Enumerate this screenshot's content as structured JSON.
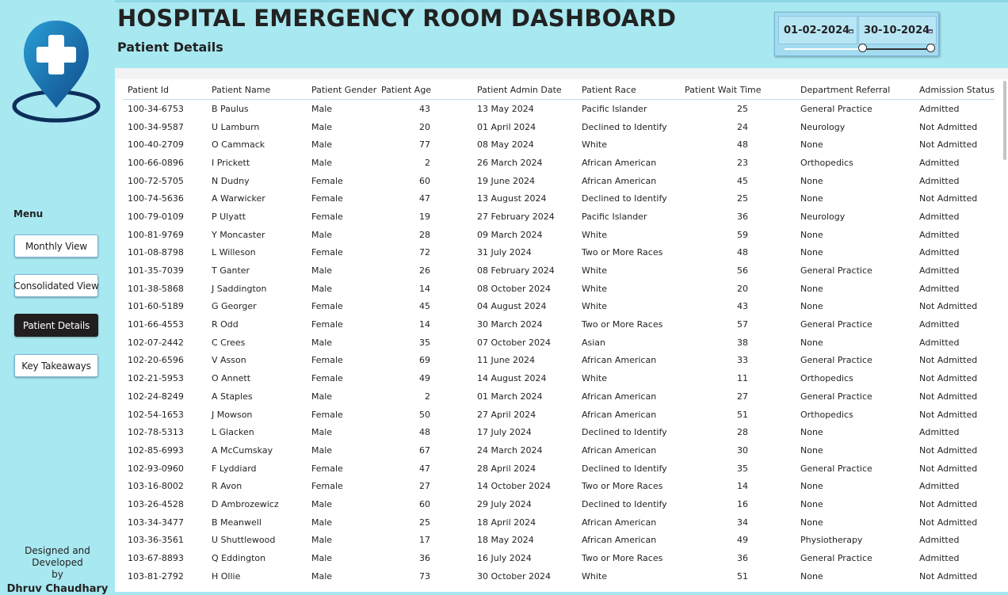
{
  "header": {
    "title": "HOSPITAL EMERGENCY ROOM DASHBOARD",
    "subtitle": "Patient Details"
  },
  "date_filter": {
    "start": "01-02-2024",
    "end": "30-10-2024",
    "range_fraction": [
      0.53,
      1.0
    ]
  },
  "sidebar": {
    "menu_label": "Menu",
    "items": [
      {
        "label": "Monthly View"
      },
      {
        "label": "Consolidated View"
      },
      {
        "label": "Patient Details",
        "active": true
      },
      {
        "label": "Key Takeaways"
      }
    ],
    "credit_line1": "Designed and Developed",
    "credit_line2": "by",
    "credit_name": "Dhruv Chaudhary"
  },
  "colors": {
    "background": "#a8e8f0",
    "active_button": "#221e20",
    "logo_blue": "#1a7fb5",
    "logo_dark": "#0d2d5a"
  },
  "table": {
    "columns": [
      "Patient Id",
      "Patient Name",
      "Patient Gender",
      "Patient Age",
      "Patient Admin Date",
      "Patient Race",
      "Patient Wait Time",
      "Department Referral",
      "Admission Status"
    ],
    "rows": [
      [
        "100-34-6753",
        "B Paulus",
        "Male",
        "43",
        "13 May 2024",
        "Pacific Islander",
        "25",
        "General Practice",
        "Admitted"
      ],
      [
        "100-34-9587",
        "U Lamburn",
        "Male",
        "20",
        "01 April 2024",
        "Declined to Identify",
        "24",
        "Neurology",
        "Not Admitted"
      ],
      [
        "100-40-2709",
        "O Cammack",
        "Male",
        "77",
        "08 May 2024",
        "White",
        "48",
        "None",
        "Not Admitted"
      ],
      [
        "100-66-0896",
        "I Prickett",
        "Male",
        "2",
        "26 March 2024",
        "African American",
        "23",
        "Orthopedics",
        "Admitted"
      ],
      [
        "100-72-5705",
        "N Dudny",
        "Female",
        "60",
        "19 June 2024",
        "African American",
        "45",
        "None",
        "Admitted"
      ],
      [
        "100-74-5636",
        "A Warwicker",
        "Female",
        "47",
        "13 August 2024",
        "Declined to Identify",
        "25",
        "None",
        "Not Admitted"
      ],
      [
        "100-79-0109",
        "P Ulyatt",
        "Female",
        "19",
        "27 February 2024",
        "Pacific Islander",
        "36",
        "Neurology",
        "Admitted"
      ],
      [
        "100-81-9769",
        "Y Moncaster",
        "Male",
        "28",
        "09 March 2024",
        "White",
        "59",
        "None",
        "Admitted"
      ],
      [
        "101-08-8798",
        "L Willeson",
        "Female",
        "72",
        "31 July 2024",
        "Two or More Races",
        "48",
        "None",
        "Admitted"
      ],
      [
        "101-35-7039",
        "T Ganter",
        "Male",
        "26",
        "08 February 2024",
        "White",
        "56",
        "General Practice",
        "Admitted"
      ],
      [
        "101-38-5868",
        "J Saddington",
        "Male",
        "14",
        "08 October 2024",
        "White",
        "20",
        "None",
        "Admitted"
      ],
      [
        "101-60-5189",
        "G Georger",
        "Female",
        "45",
        "04 August 2024",
        "White",
        "43",
        "None",
        "Not Admitted"
      ],
      [
        "101-66-4553",
        "R Odd",
        "Female",
        "14",
        "30 March 2024",
        "Two or More Races",
        "57",
        "General Practice",
        "Admitted"
      ],
      [
        "102-07-2442",
        "C Crees",
        "Male",
        "35",
        "07 October 2024",
        "Asian",
        "38",
        "None",
        "Admitted"
      ],
      [
        "102-20-6596",
        "V Asson",
        "Female",
        "69",
        "11 June 2024",
        "African American",
        "33",
        "General Practice",
        "Not Admitted"
      ],
      [
        "102-21-5953",
        "O Annett",
        "Female",
        "49",
        "14 August 2024",
        "White",
        "11",
        "Orthopedics",
        "Not Admitted"
      ],
      [
        "102-24-8249",
        "A Staples",
        "Male",
        "2",
        "01 March 2024",
        "African American",
        "27",
        "General Practice",
        "Not Admitted"
      ],
      [
        "102-54-1653",
        "J Mowson",
        "Female",
        "50",
        "27 April 2024",
        "African American",
        "51",
        "Orthopedics",
        "Not Admitted"
      ],
      [
        "102-78-5313",
        "L Glacken",
        "Male",
        "48",
        "17 July 2024",
        "Declined to Identify",
        "28",
        "None",
        "Admitted"
      ],
      [
        "102-85-6993",
        "A McCumskay",
        "Male",
        "67",
        "24 March 2024",
        "African American",
        "30",
        "None",
        "Not Admitted"
      ],
      [
        "102-93-0960",
        "F Lyddiard",
        "Female",
        "47",
        "28 April 2024",
        "Declined to Identify",
        "35",
        "General Practice",
        "Not Admitted"
      ],
      [
        "103-16-8002",
        "R Avon",
        "Female",
        "27",
        "14 October 2024",
        "Two or More Races",
        "14",
        "None",
        "Admitted"
      ],
      [
        "103-26-4528",
        "D Ambrozewicz",
        "Male",
        "60",
        "29 July 2024",
        "Declined to Identify",
        "16",
        "None",
        "Not Admitted"
      ],
      [
        "103-34-3477",
        "B Meanwell",
        "Male",
        "25",
        "18 April 2024",
        "African American",
        "34",
        "None",
        "Not Admitted"
      ],
      [
        "103-36-3561",
        "U Shuttlewood",
        "Male",
        "17",
        "18 May 2024",
        "African American",
        "49",
        "Physiotherapy",
        "Admitted"
      ],
      [
        "103-67-8893",
        "Q Eddington",
        "Male",
        "36",
        "16 July 2024",
        "Two or More Races",
        "36",
        "General Practice",
        "Admitted"
      ],
      [
        "103-81-2792",
        "H Ollie",
        "Male",
        "73",
        "30 October 2024",
        "White",
        "51",
        "None",
        "Not Admitted"
      ]
    ]
  }
}
